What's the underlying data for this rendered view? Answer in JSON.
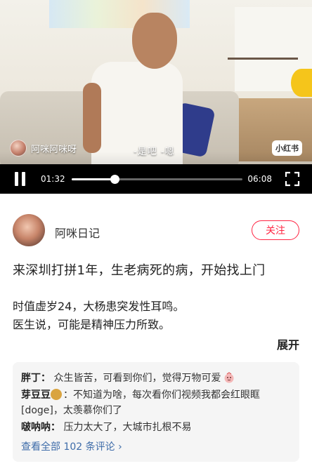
{
  "video": {
    "watermark_user": "阿咪阿咪呀",
    "subtitle": "-是吧 -嗯",
    "logo": "小红书",
    "current_time": "01:32",
    "total_time": "06:08",
    "progress_fraction": 0.25
  },
  "author": {
    "name": "阿咪日记",
    "follow_label": "关注"
  },
  "post": {
    "title": "来深圳打拼1年，生老病死的病，开始找上门",
    "body_line1": "时值虚岁24，大杨患突发性耳鸣。",
    "body_line2": "医生说，可能是精神压力所致。",
    "expand_label": "展开"
  },
  "comments": {
    "items": [
      {
        "user": "胖丁：",
        "text": " 众生皆苦，可看到你们，觉得万物可爱"
      },
      {
        "user": "芽豆豆",
        "text": "：不知道为啥，每次看你们视频我都会红眼眶 [doge]，太羡慕你们了"
      },
      {
        "user": "啵呐呐：",
        "text": " 压力太大了，大城市扎根不易"
      }
    ],
    "view_all": "查看全部 102 条评论"
  },
  "colors": {
    "accent": "#ff2442",
    "link": "#3e6ca9"
  }
}
